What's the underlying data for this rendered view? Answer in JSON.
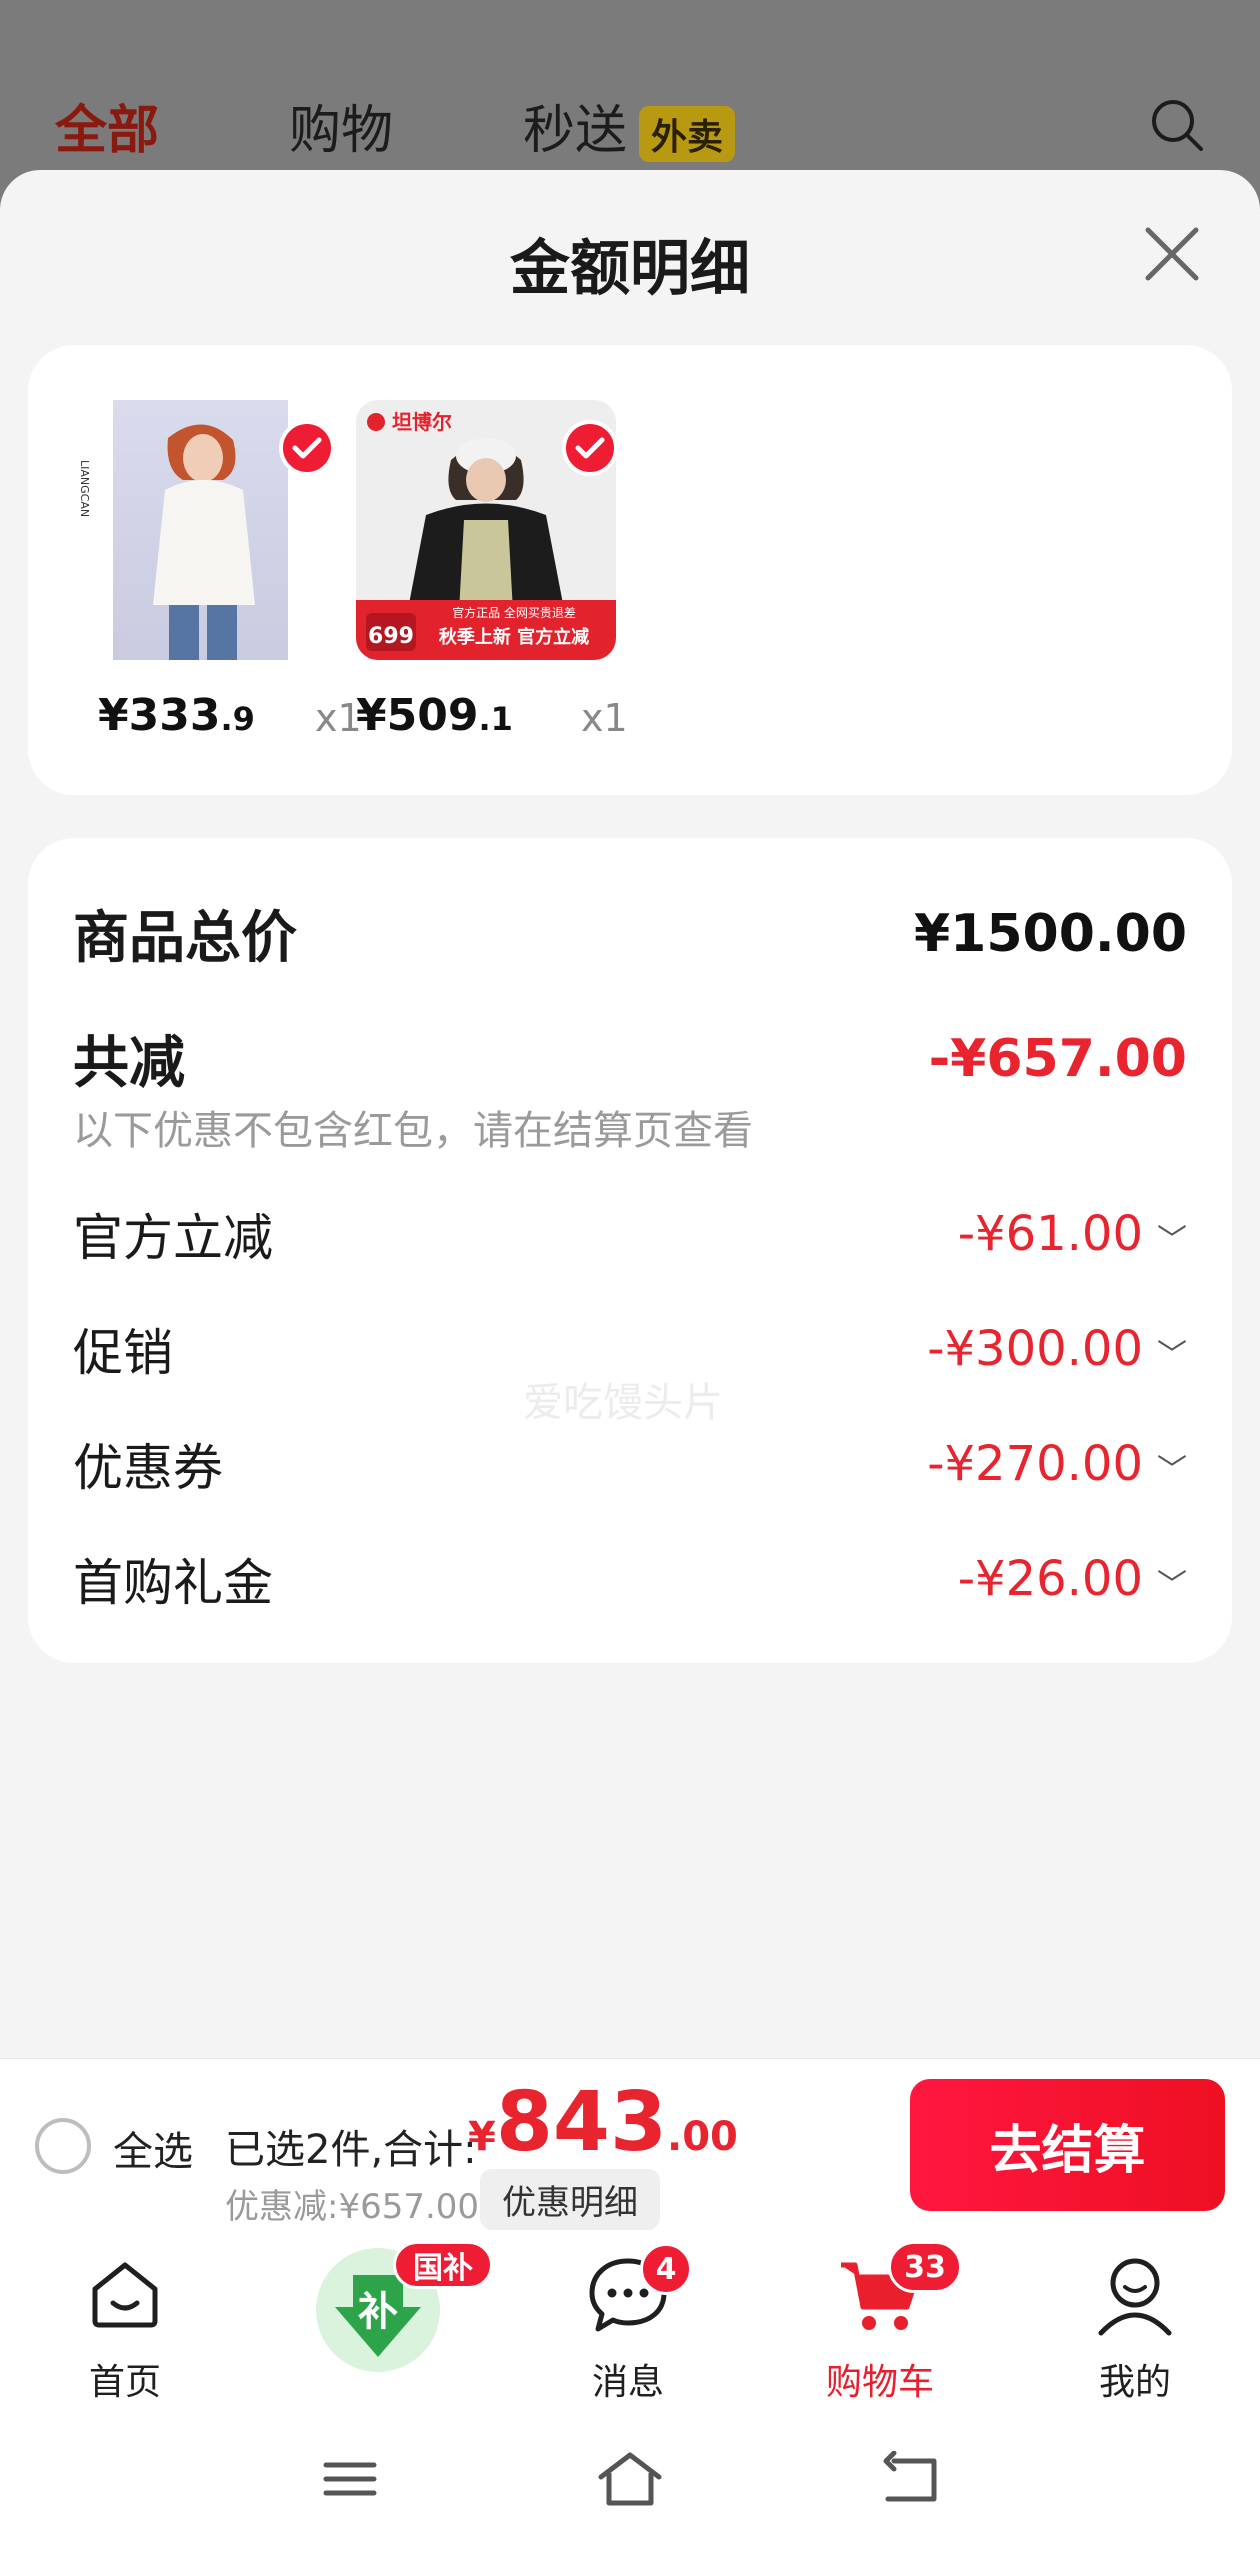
{
  "background": {
    "tabs": [
      "全部",
      "购物",
      "秒送"
    ],
    "delivery_badge": "外卖"
  },
  "sheet": {
    "title": "金额明细"
  },
  "products": [
    {
      "price_int": "¥333",
      "price_dec": ".9",
      "qty": "x1"
    },
    {
      "price_int": "¥509",
      "price_dec": ".1",
      "qty": "x1"
    }
  ],
  "product2_tags": {
    "brand": "坦博尔",
    "price_tag": "699",
    "banner": "秋季上新 官方立减",
    "tag_small": "官方正品 全网买贵退差"
  },
  "detail": {
    "total_label": "商品总价",
    "total_amount": "¥1500.00",
    "reduce_label": "共减",
    "reduce_amount": "-¥657.00",
    "note": "以下优惠不包含红包，请在结算页查看",
    "watermark": "爱吃馒头片",
    "items": [
      {
        "label": "官方立减",
        "amount": "-¥61.00"
      },
      {
        "label": "促销",
        "amount": "-¥300.00"
      },
      {
        "label": "优惠券",
        "amount": "-¥270.00"
      },
      {
        "label": "首购礼金",
        "amount": "-¥26.00"
      }
    ]
  },
  "checkout": {
    "select_all": "全选",
    "summary": "已选2件,合计:",
    "currency": "¥",
    "total_int": "843",
    "total_dec": ".00",
    "discount": "优惠减:¥657.00",
    "detail_button": "优惠明细",
    "pay_button": "去结算"
  },
  "tabbar": {
    "items": [
      {
        "label": "首页"
      },
      {
        "label": "",
        "badge": "国补",
        "icon_text": "补"
      },
      {
        "label": "消息",
        "badge": "4"
      },
      {
        "label": "购物车",
        "badge": "33"
      },
      {
        "label": "我的"
      }
    ]
  },
  "colors": {
    "accent_red": "#e8242f",
    "pay_button": "#ee0f22"
  }
}
